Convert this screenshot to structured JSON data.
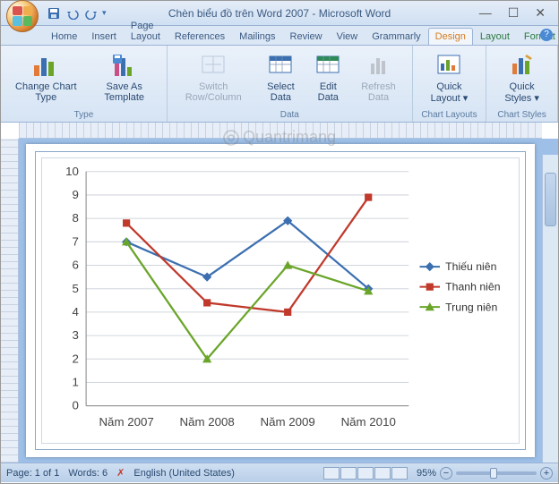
{
  "title": "Chèn biểu đồ trên Word 2007 - Microsoft Word",
  "qat": {
    "save": "save-icon",
    "undo": "undo-icon",
    "redo": "redo-icon"
  },
  "tabs": [
    "Home",
    "Insert",
    "Page Layout",
    "References",
    "Mailings",
    "Review",
    "View",
    "Grammarly",
    "Design",
    "Layout",
    "Format"
  ],
  "active_tab": "Design",
  "ribbon": {
    "type": {
      "label": "Type",
      "items": [
        {
          "label": "Change Chart Type",
          "key": "change_chart_type"
        },
        {
          "label": "Save As Template",
          "key": "save_as_template"
        }
      ]
    },
    "data": {
      "label": "Data",
      "items": [
        {
          "label": "Switch Row/Column",
          "key": "switch_rc",
          "disabled": true
        },
        {
          "label": "Select Data",
          "key": "select_data"
        },
        {
          "label": "Edit Data",
          "key": "edit_data"
        },
        {
          "label": "Refresh Data",
          "key": "refresh_data",
          "disabled": true
        }
      ]
    },
    "layouts": {
      "label": "Chart Layouts",
      "items": [
        {
          "label": "Quick Layout ▾",
          "key": "quick_layout"
        }
      ]
    },
    "styles": {
      "label": "Chart Styles",
      "items": [
        {
          "label": "Quick Styles ▾",
          "key": "quick_styles"
        }
      ]
    }
  },
  "status": {
    "page": "Page: 1 of 1",
    "words": "Words: 6",
    "lang": "English (United States)",
    "zoom": "95%"
  },
  "watermark": "Quantrimang",
  "chart_data": {
    "type": "line",
    "categories": [
      "Năm 2007",
      "Năm 2008",
      "Năm 2009",
      "Năm 2010"
    ],
    "series": [
      {
        "name": "Thiếu niên",
        "color": "#3b6fb0",
        "values": [
          7.0,
          5.5,
          7.9,
          5.0
        ]
      },
      {
        "name": "Thanh niên",
        "color": "#c0392b",
        "values": [
          7.8,
          4.4,
          4.0,
          8.9
        ]
      },
      {
        "name": "Trung niên",
        "color": "#6aa52a",
        "values": [
          7.0,
          2.0,
          6.0,
          4.9
        ]
      }
    ],
    "ylim": [
      0,
      10
    ],
    "yticks": [
      0,
      1,
      2,
      3,
      4,
      5,
      6,
      7,
      8,
      9,
      10
    ],
    "xlabel": "",
    "ylabel": "",
    "title": ""
  }
}
